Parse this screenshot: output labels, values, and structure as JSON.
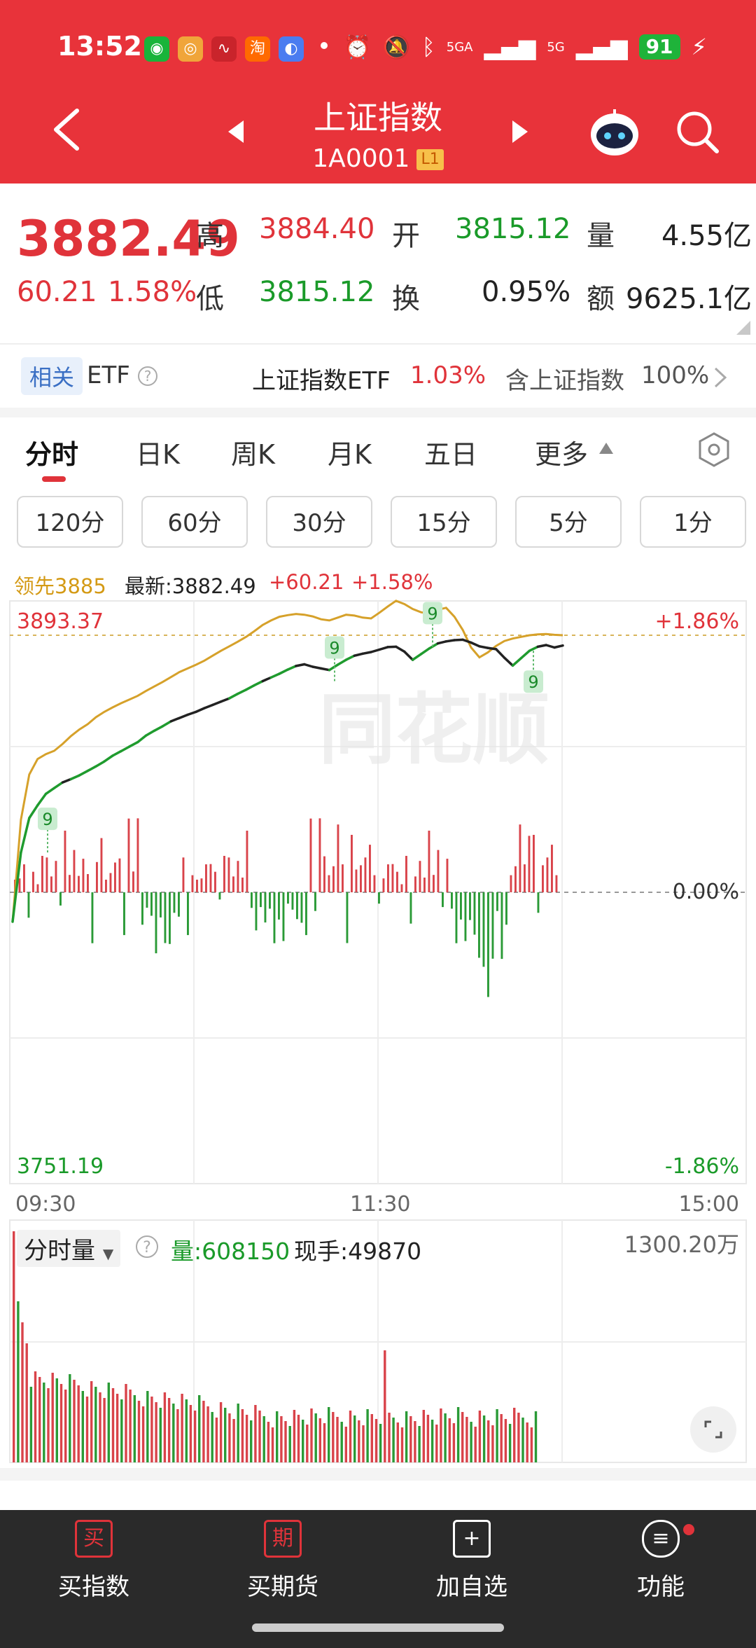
{
  "status_bar": {
    "time": "13:52",
    "app_icons": [
      "wechat-icon",
      "weibo-icon",
      "stock-app-icon",
      "taobao-icon",
      "browser-icon"
    ],
    "indicators": [
      "alarm-icon",
      "mute-icon",
      "bluetooth-icon",
      "signal-5g-icon"
    ],
    "network_a": "5GA",
    "network_b": "5G",
    "battery": "91"
  },
  "header": {
    "title": "上证指数",
    "code": "1A0001",
    "level_badge": "L1"
  },
  "quote": {
    "price": "3882.49",
    "change": "60.21",
    "change_pct": "1.58%",
    "high_label": "高",
    "high": "3884.40",
    "open_label": "开",
    "open": "3815.12",
    "volume_label": "量",
    "volume": "4.55亿",
    "low_label": "低",
    "low": "3815.12",
    "turnover_label": "换",
    "turnover": "0.95%",
    "amount_label": "额",
    "amount": "9625.1亿"
  },
  "etf": {
    "tag": "相关",
    "label": "ETF",
    "name": "上证指数ETF",
    "pct": "1.03%",
    "contains": "含上证指数",
    "weight": "100%"
  },
  "tabs": [
    "分时",
    "日K",
    "周K",
    "月K",
    "五日",
    "更多"
  ],
  "periods": [
    "120分",
    "60分",
    "30分",
    "15分",
    "5分",
    "1分"
  ],
  "legend": {
    "lead": "领先3885",
    "latest": "最新:3882.49",
    "chg": "+60.21",
    "pct": "+1.58%"
  },
  "chart_data": {
    "type": "line",
    "y_max": "3893.37",
    "y_min": "3751.19",
    "pct_max": "+1.86%",
    "pct_mid": "0.00%",
    "pct_min": "-1.86%",
    "x_ticks": [
      "09:30",
      "11:30",
      "15:00"
    ],
    "ylim": [
      3751.19,
      3893.37
    ],
    "prev_close": 3822.28,
    "markers": [
      "9",
      "9",
      "9",
      "9"
    ],
    "series": [
      {
        "role": "index",
        "values": [
          3815.1,
          3832.0,
          3840.4,
          3843.5,
          3846.3,
          3847.7,
          3849.1,
          3849.9,
          3850.8,
          3851.9,
          3853.0,
          3854.2,
          3855.6,
          3856.7,
          3857.8,
          3858.9,
          3860.5,
          3861.7,
          3862.8,
          3864.0,
          3864.8,
          3865.6,
          3866.3,
          3867.2,
          3868.0,
          3868.8,
          3869.6,
          3870.7,
          3871.7,
          3872.8,
          3873.8,
          3874.7,
          3875.6,
          3876.6,
          3877.5,
          3877.9,
          3877.3,
          3876.9,
          3876.5,
          3877.8,
          3879.0,
          3880.0,
          3880.5,
          3880.9,
          3881.5,
          3882.1,
          3882.2,
          3881.0,
          3879.0,
          3880.4,
          3881.8,
          3883.0,
          3883.5,
          3883.8,
          3883.9,
          3883.2,
          3882.3,
          3881.9,
          3881.6,
          3879.5,
          3877.6,
          3879.4,
          3881.2,
          3882.2,
          3882.6,
          3882.0,
          3882.49
        ]
      },
      {
        "role": "leading",
        "values": [
          3815.1,
          3840.0,
          3851.0,
          3854.8,
          3856.0,
          3856.8,
          3858.5,
          3860.4,
          3862.0,
          3863.3,
          3865.0,
          3866.3,
          3867.4,
          3868.4,
          3869.3,
          3870.2,
          3871.4,
          3872.5,
          3873.6,
          3874.8,
          3876.0,
          3876.9,
          3877.8,
          3878.8,
          3880.0,
          3881.2,
          3882.3,
          3883.4,
          3884.6,
          3886.0,
          3887.5,
          3888.6,
          3889.5,
          3889.9,
          3890.2,
          3890.0,
          3889.6,
          3888.9,
          3888.6,
          3889.3,
          3890.0,
          3889.8,
          3889.3,
          3889.1,
          3890.5,
          3892.0,
          3893.4,
          3892.6,
          3891.4,
          3890.6,
          3890.3,
          3891.2,
          3891.7,
          3889.5,
          3886.3,
          3882.0,
          3879.6,
          3880.8,
          3882.4,
          3883.6,
          3884.2,
          3884.6,
          3885.0,
          3885.2,
          3885.3,
          3885.1,
          3885.0
        ]
      }
    ],
    "volume_label": "分时量",
    "volume_reading": "量:608150",
    "hand_reading": "现手:49870",
    "volume_max": "1300.20万"
  },
  "bottom_nav": [
    {
      "icon": "buy-index-icon",
      "glyph": "买",
      "label": "买指数"
    },
    {
      "icon": "futures-icon",
      "glyph": "期",
      "label": "买期货"
    },
    {
      "icon": "add-watchlist-icon",
      "glyph": "+",
      "label": "加自选"
    },
    {
      "icon": "function-menu-icon",
      "glyph": "≡",
      "label": "功能"
    }
  ]
}
